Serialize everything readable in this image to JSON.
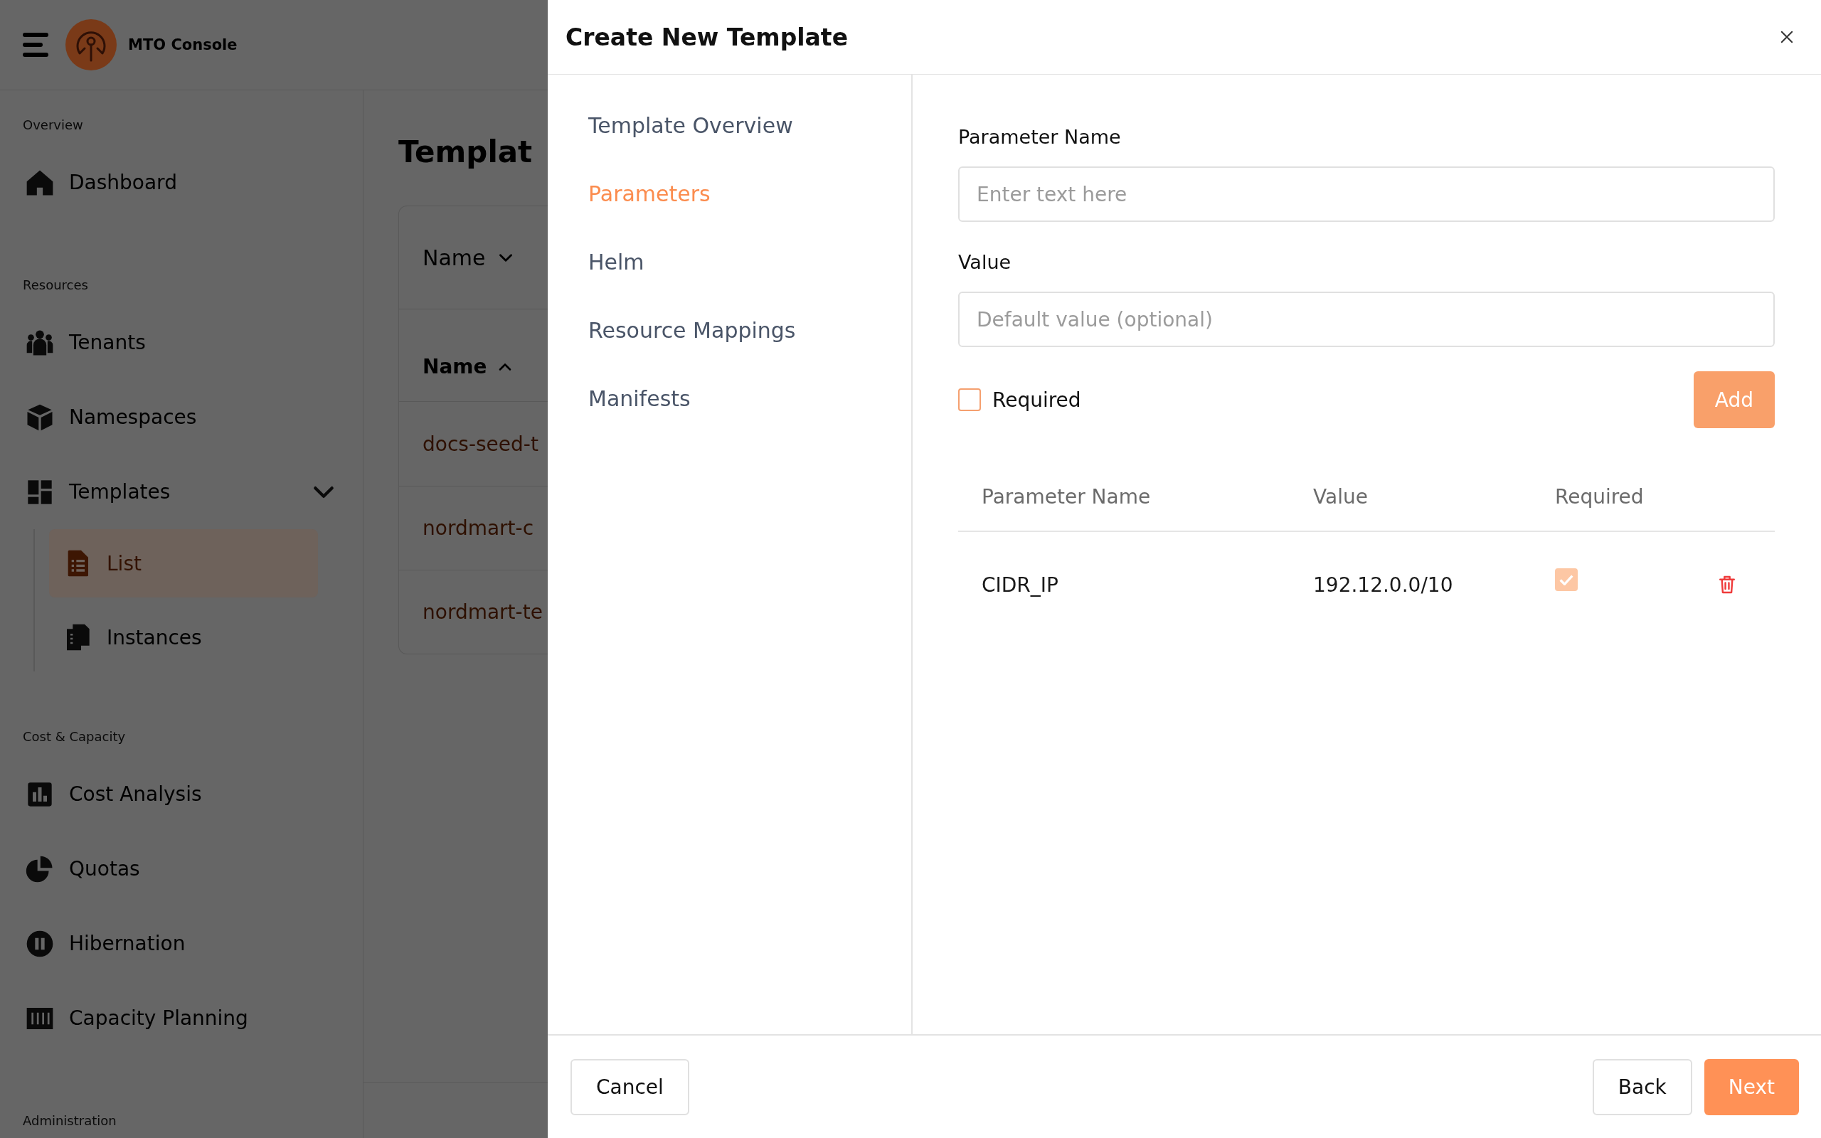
{
  "app": {
    "brand": "MTO Console",
    "sidebar": {
      "sections": [
        {
          "label": "Overview",
          "items": [
            {
              "label": "Dashboard",
              "selected": false
            }
          ]
        },
        {
          "label": "Resources",
          "items": [
            {
              "label": "Tenants",
              "selected": false
            },
            {
              "label": "Namespaces",
              "selected": false
            },
            {
              "label": "Templates",
              "selected": false,
              "expanded": true,
              "children": [
                {
                  "label": "List",
                  "selected": true
                },
                {
                  "label": "Instances",
                  "selected": false
                }
              ]
            }
          ]
        },
        {
          "label": "Cost & Capacity",
          "items": [
            {
              "label": "Cost Analysis",
              "selected": false
            },
            {
              "label": "Quotas",
              "selected": false
            },
            {
              "label": "Hibernation",
              "selected": false
            },
            {
              "label": "Capacity Planning",
              "selected": false
            }
          ]
        },
        {
          "label": "Administration"
        }
      ]
    },
    "page": {
      "title": "Templat",
      "filter": {
        "label": "Name"
      },
      "table": {
        "columns": [
          {
            "label": "Name",
            "sort_ascending": true
          }
        ],
        "rows": [
          {
            "name": "docs-seed-t"
          },
          {
            "name": "nordmart-c"
          },
          {
            "name": "nordmart-te"
          }
        ]
      }
    }
  },
  "modal": {
    "title": "Create New Template",
    "steps": [
      {
        "label": "Template Overview",
        "selected": false
      },
      {
        "label": "Parameters",
        "selected": true
      },
      {
        "label": "Helm",
        "selected": false
      },
      {
        "label": "Resource Mappings",
        "selected": false
      },
      {
        "label": "Manifests",
        "selected": false
      }
    ],
    "form": {
      "fields": [
        {
          "label": "Parameter Name",
          "placeholder": "Enter text here"
        },
        {
          "label": "Value",
          "placeholder": "Default value (optional)"
        }
      ],
      "required": {
        "label": "Required",
        "checked": false
      },
      "add_button": {
        "label": "Add",
        "disabled": true
      }
    },
    "table": {
      "columns": [
        {
          "label": "Parameter Name"
        },
        {
          "label": "Value"
        },
        {
          "label": "Required"
        }
      ],
      "rows": [
        {
          "name": "CIDR_IP",
          "value": "192.12.0.0/10",
          "required": true
        }
      ]
    },
    "footer": {
      "left_buttons": [
        {
          "label": "Cancel",
          "kind": "outline"
        }
      ],
      "right_buttons": [
        {
          "label": "Back",
          "kind": "outline"
        },
        {
          "label": "Next",
          "kind": "primary"
        }
      ]
    }
  }
}
